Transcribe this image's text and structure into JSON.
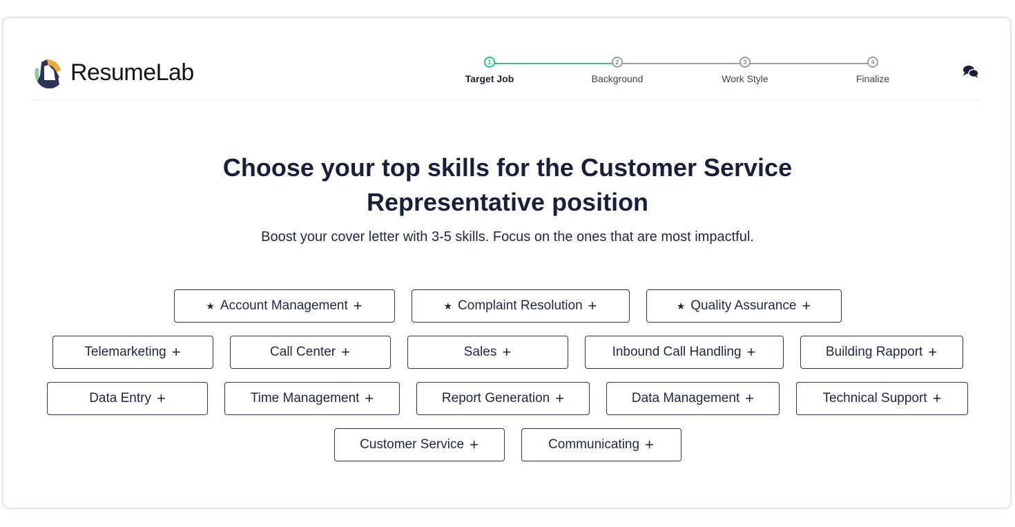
{
  "brand": {
    "name_part1": "Resume",
    "name_part2": "Lab",
    "colors": {
      "navy": "#2b3553",
      "orange": "#f3a83b",
      "teal": "#8fc6a8"
    }
  },
  "stepper": {
    "progress_fraction": 0.333,
    "steps": [
      {
        "number": "1",
        "label": "Target Job",
        "state": "active"
      },
      {
        "number": "2",
        "label": "Background",
        "state": "pending"
      },
      {
        "number": "3",
        "label": "Work Style",
        "state": "pending"
      },
      {
        "number": "4",
        "label": "Finalize",
        "state": "pending"
      }
    ],
    "accent": "#1ec78a"
  },
  "header": {
    "chat_icon": "chat-bubbles-icon"
  },
  "main": {
    "title_line1": "Choose your top skills for the Customer Service",
    "title_line2": "Representative position",
    "subtitle": "Boost your cover letter with 3-5 skills. Focus on the ones that are most impactful."
  },
  "skills": {
    "rows": [
      [
        {
          "label": "Account Management",
          "recommended": true
        },
        {
          "label": "Complaint Resolution",
          "recommended": true
        },
        {
          "label": "Quality Assurance",
          "recommended": true
        }
      ],
      [
        {
          "label": "Telemarketing",
          "recommended": false
        },
        {
          "label": "Call Center",
          "recommended": false
        },
        {
          "label": "Sales",
          "recommended": false
        },
        {
          "label": "Inbound Call Handling",
          "recommended": false
        },
        {
          "label": "Building Rapport",
          "recommended": false
        }
      ],
      [
        {
          "label": "Data Entry",
          "recommended": false
        },
        {
          "label": "Time Management",
          "recommended": false
        },
        {
          "label": "Report Generation",
          "recommended": false
        },
        {
          "label": "Data Management",
          "recommended": false
        },
        {
          "label": "Technical Support",
          "recommended": false
        }
      ],
      [
        {
          "label": "Customer Service",
          "recommended": false
        },
        {
          "label": "Communicating",
          "recommended": false
        }
      ]
    ],
    "star_glyph": "★",
    "plus_glyph": "+"
  }
}
